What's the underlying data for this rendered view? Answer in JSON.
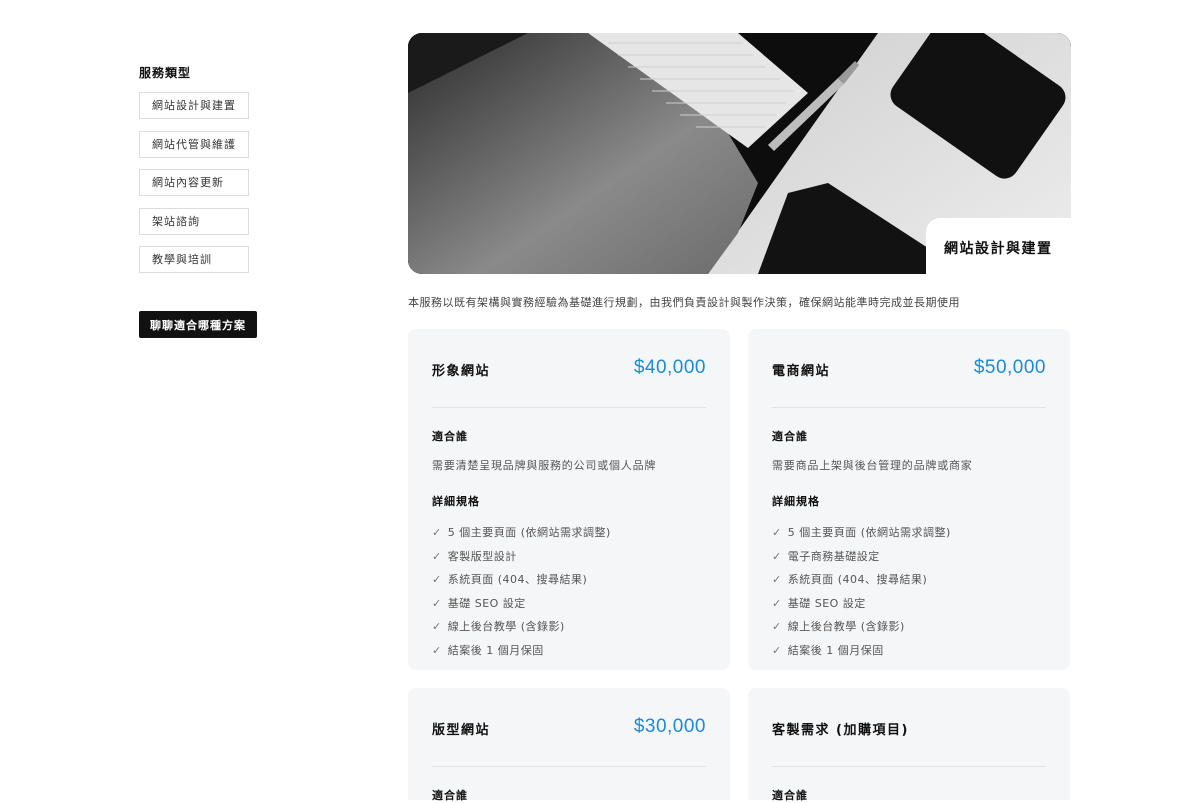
{
  "sidebar": {
    "title": "服務類型",
    "items": [
      {
        "label": "網站設計與建置"
      },
      {
        "label": "網站代管與維護"
      },
      {
        "label": "網站內容更新"
      },
      {
        "label": "架站諮詢"
      },
      {
        "label": "教學與培訓"
      }
    ],
    "cta": "聊聊適合哪種方案"
  },
  "hero": {
    "label": "網站設計與建置"
  },
  "intro": "本服務以既有架構與實務經驗為基礎進行規劃，由我們負責設計與製作決策，確保網站能準時完成並長期使用",
  "check_icon": "✓",
  "colors": {
    "price": "#1b8bd6",
    "card_bg": "#f5f6f8",
    "cta_bg": "#111111"
  },
  "plans": [
    {
      "name": "形象網站",
      "price": "$40,000",
      "who_title": "適合誰",
      "who": "需要清楚呈現品牌與服務的公司或個人品牌",
      "spec_title": "詳細規格",
      "specs": [
        "5 個主要頁面 (依網站需求調整)",
        "客製版型設計",
        "系統頁面 (404、搜尋結果)",
        "基礎 SEO 設定",
        "線上後台教學 (含錄影)",
        "結案後 1 個月保固"
      ]
    },
    {
      "name": "電商網站",
      "price": "$50,000",
      "who_title": "適合誰",
      "who": "需要商品上架與後台管理的品牌或商家",
      "spec_title": "詳細規格",
      "specs": [
        "5 個主要頁面 (依網站需求調整)",
        "電子商務基礎設定",
        "系統頁面 (404、搜尋結果)",
        "基礎 SEO 設定",
        "線上後台教學 (含錄影)",
        "結案後 1 個月保固"
      ]
    },
    {
      "name": "版型網站",
      "price": "$30,000",
      "who_title": "適合誰"
    },
    {
      "name": "客製需求 (加購項目)",
      "price": "",
      "who_title": "適合誰"
    }
  ]
}
